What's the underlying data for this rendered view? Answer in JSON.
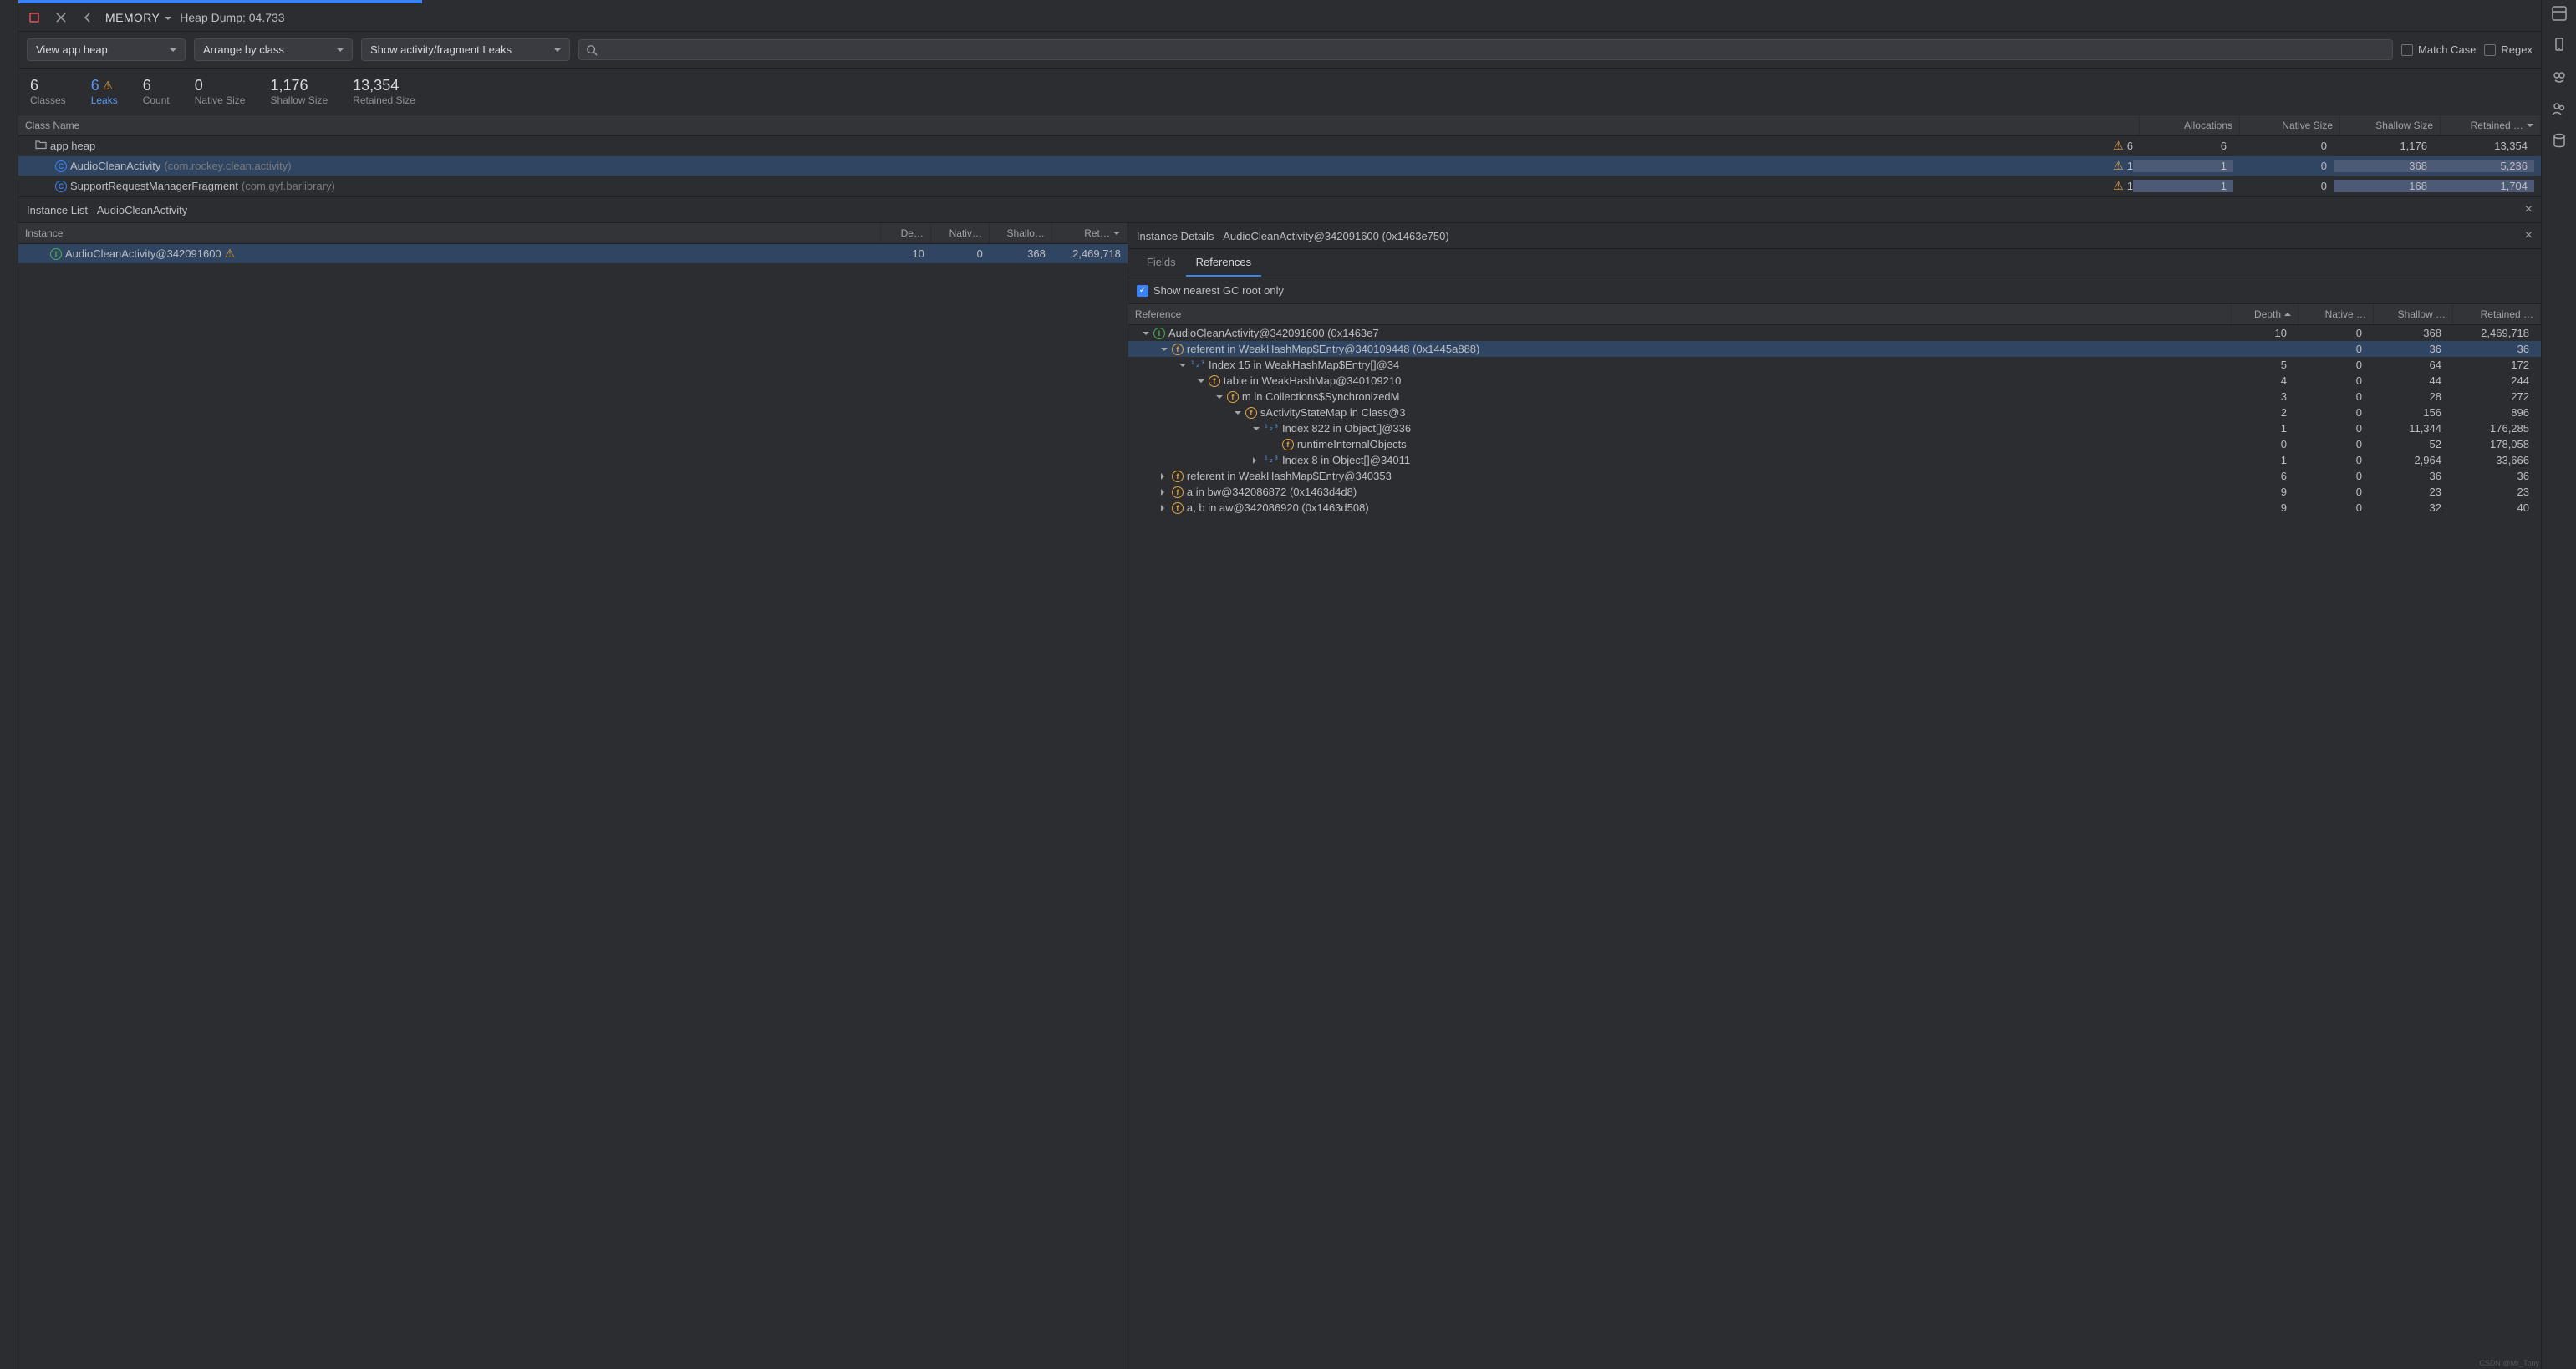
{
  "toolbar": {
    "memory_label": "MEMORY",
    "title": "Heap Dump: 04.733"
  },
  "filters": {
    "view": "View app heap",
    "arrange": "Arrange by class",
    "show": "Show activity/fragment Leaks",
    "search_placeholder": "",
    "match_case": "Match Case",
    "regex": "Regex"
  },
  "summary": {
    "classes": {
      "num": "6",
      "lbl": "Classes"
    },
    "leaks": {
      "num": "6",
      "lbl": "Leaks"
    },
    "count": {
      "num": "6",
      "lbl": "Count"
    },
    "native": {
      "num": "0",
      "lbl": "Native Size"
    },
    "shallow": {
      "num": "1,176",
      "lbl": "Shallow Size"
    },
    "retained": {
      "num": "13,354",
      "lbl": "Retained Size"
    }
  },
  "class_headers": {
    "name": "Class Name",
    "alloc": "Allocations",
    "native": "Native Size",
    "shallow": "Shallow Size",
    "retained": "Retained …"
  },
  "class_rows": [
    {
      "indent": 0,
      "icon": "folder",
      "name": "app heap",
      "pkg": "",
      "warn": "6",
      "alloc": "6",
      "native": "0",
      "shallow": "1,176",
      "retained": "13,354",
      "sel": false
    },
    {
      "indent": 1,
      "icon": "c",
      "name": "AudioCleanActivity",
      "pkg": " (com.rockey.clean.activity)",
      "warn": "1",
      "alloc": "1",
      "native": "0",
      "shallow": "368",
      "retained": "5,236",
      "sel": true,
      "hl": true
    },
    {
      "indent": 1,
      "icon": "c",
      "name": "SupportRequestManagerFragment",
      "pkg": " (com.gyf.barlibrary)",
      "warn": "1",
      "alloc": "1",
      "native": "0",
      "shallow": "168",
      "retained": "1,704",
      "sel": false,
      "hl": true
    }
  ],
  "instance_list": {
    "title": "Instance List - AudioCleanActivity",
    "headers": {
      "inst": "Instance",
      "depth": "De…",
      "native": "Nativ…",
      "shallow": "Shallo…",
      "ret": "Ret…"
    },
    "rows": [
      {
        "icon": "i",
        "name": "AudioCleanActivity@342091600",
        "warn": true,
        "depth": "10",
        "native": "0",
        "shallow": "368",
        "ret": "2,469,718"
      }
    ]
  },
  "details": {
    "title": "Instance Details - AudioCleanActivity@342091600 (0x1463e750)",
    "tab_fields": "Fields",
    "tab_refs": "References",
    "nearest": "Show nearest GC root only",
    "headers": {
      "ref": "Reference",
      "depth": "Depth",
      "native": "Native …",
      "shallow": "Shallow …",
      "retained": "Retained …"
    },
    "rows": [
      {
        "d": 0,
        "chev": "down",
        "icon": "i",
        "name": "AudioCleanActivity@342091600 (0x1463e7",
        "depth": "10",
        "n": "0",
        "s": "368",
        "r": "2,469,718"
      },
      {
        "d": 1,
        "chev": "down",
        "icon": "f",
        "name": "referent in WeakHashMap$Entry@340109448 (0x1445a888)",
        "depth": "",
        "n": "0",
        "s": "36",
        "r": "36",
        "sel": true
      },
      {
        "d": 2,
        "chev": "down",
        "icon": "idx",
        "name": "Index 15 in WeakHashMap$Entry[]@34",
        "depth": "5",
        "n": "0",
        "s": "64",
        "r": "172"
      },
      {
        "d": 3,
        "chev": "down",
        "icon": "f",
        "name": "table in WeakHashMap@340109210",
        "depth": "4",
        "n": "0",
        "s": "44",
        "r": "244"
      },
      {
        "d": 4,
        "chev": "down",
        "icon": "f",
        "name": "m in Collections$SynchronizedM",
        "depth": "3",
        "n": "0",
        "s": "28",
        "r": "272"
      },
      {
        "d": 5,
        "chev": "down",
        "icon": "f",
        "name": "sActivityStateMap in Class@3",
        "depth": "2",
        "n": "0",
        "s": "156",
        "r": "896"
      },
      {
        "d": 6,
        "chev": "down",
        "icon": "idx",
        "name": "Index 822 in Object[]@336",
        "depth": "1",
        "n": "0",
        "s": "11,344",
        "r": "176,285"
      },
      {
        "d": 7,
        "chev": "none",
        "icon": "f",
        "name": "runtimeInternalObjects",
        "depth": "0",
        "n": "0",
        "s": "52",
        "r": "178,058"
      },
      {
        "d": 6,
        "chev": "right",
        "icon": "idx",
        "name": "Index 8 in Object[]@34011",
        "depth": "1",
        "n": "0",
        "s": "2,964",
        "r": "33,666"
      },
      {
        "d": 1,
        "chev": "right",
        "icon": "f",
        "name": "referent in WeakHashMap$Entry@340353",
        "depth": "6",
        "n": "0",
        "s": "36",
        "r": "36"
      },
      {
        "d": 1,
        "chev": "right",
        "icon": "f",
        "name": "a in bw@342086872 (0x1463d4d8)",
        "depth": "9",
        "n": "0",
        "s": "23",
        "r": "23"
      },
      {
        "d": 1,
        "chev": "right",
        "icon": "f",
        "name": "a, b in aw@342086920 (0x1463d508)",
        "depth": "9",
        "n": "0",
        "s": "32",
        "r": "40"
      }
    ]
  },
  "watermark": "CSDN @Mr_Tony"
}
